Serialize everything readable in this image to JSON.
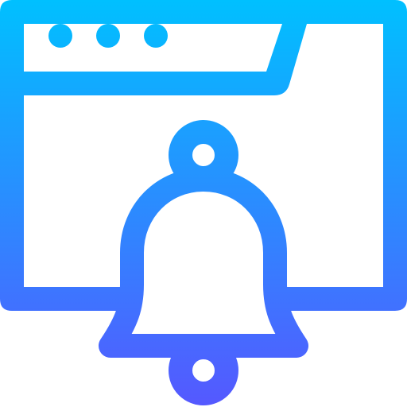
{
  "icon": {
    "name": "browser-notification-bell-icon",
    "gradient": {
      "top_color": "#00c0ff",
      "bottom_color": "#5558ff"
    },
    "parts": {
      "window": "browser-window-icon",
      "window_dots": [
        "window-dot-icon",
        "window-dot-icon",
        "window-dot-icon"
      ],
      "tab": "browser-tab-icon",
      "bell": "bell-icon",
      "bell_top_ring": "bell-top-ring-icon",
      "bell_clapper": "bell-clapper-icon"
    }
  }
}
